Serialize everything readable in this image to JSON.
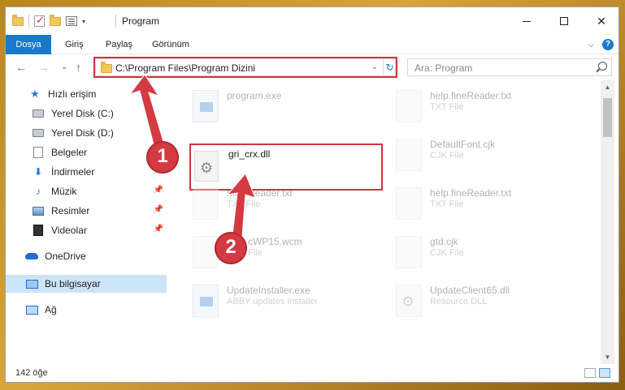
{
  "window": {
    "title": "Program",
    "quick_access": {
      "dropdown_glyph": "▾"
    },
    "controls": {
      "close": "✕"
    }
  },
  "ribbon": {
    "tabs": [
      "Dosya",
      "Giriş",
      "Paylaş",
      "Görünüm"
    ],
    "expand_glyph": "⌵",
    "help_label": "?"
  },
  "navigation": {
    "back": "←",
    "forward": "→",
    "recent": "⌄",
    "up": "↑"
  },
  "address_bar": {
    "path": "C:\\Program Files\\Program Dizini",
    "dropdown_glyph": "⌄",
    "refresh_glyph": "↻"
  },
  "search": {
    "placeholder": "Ara: Program"
  },
  "sidebar": {
    "items": [
      {
        "label": "Hızlı erişim",
        "icon": "star-icon"
      },
      {
        "label": "Yerel Disk (C:)",
        "icon": "drive-icon"
      },
      {
        "label": "Yerel Disk (D:)",
        "icon": "drive-icon"
      },
      {
        "label": "Belgeler",
        "icon": "document-icon"
      },
      {
        "label": "İndirmeler",
        "icon": "download-icon",
        "pinned": true
      },
      {
        "label": "Müzik",
        "icon": "music-icon",
        "pinned": true
      },
      {
        "label": "Resimler",
        "icon": "pictures-icon",
        "pinned": true
      },
      {
        "label": "Videolar",
        "icon": "video-icon",
        "pinned": true
      },
      {
        "label": "OneDrive",
        "icon": "cloud-icon"
      },
      {
        "label": "Bu bilgisayar",
        "icon": "computer-icon",
        "selected": true
      },
      {
        "label": "Ağ",
        "icon": "network-icon"
      }
    ],
    "pin_glyph": "📌"
  },
  "files": {
    "left": [
      {
        "name": "program.exe",
        "type": ""
      },
      {
        "name": "gri_crx.dll",
        "type": ""
      },
      {
        "name": "h",
        "type": "TXT File",
        "name_tail": "fineReader.txt"
      },
      {
        "name": "",
        "type": "File",
        "name_tail": "cWP15.wcm"
      },
      {
        "name": "UpdateInstaller.exe",
        "type": "ABBY updates installer"
      }
    ],
    "right": [
      {
        "name": "help.fineReader.txt",
        "type": "TXT File"
      },
      {
        "name": "DefaultFont.cjk",
        "type": "CJK File"
      },
      {
        "name": "help.fineReader.txt",
        "type": "TXT File"
      },
      {
        "name": "gtd.cjk",
        "type": "CJK File"
      },
      {
        "name": "UpdateClient65.dll",
        "type": "Resource DLL"
      }
    ]
  },
  "callouts": {
    "one": "1",
    "two": "2"
  },
  "status_bar": {
    "item_count": "142 öğe"
  },
  "colors": {
    "accent": "#1979ca",
    "callout": "#d43a42",
    "selection": "#cce4f7"
  }
}
